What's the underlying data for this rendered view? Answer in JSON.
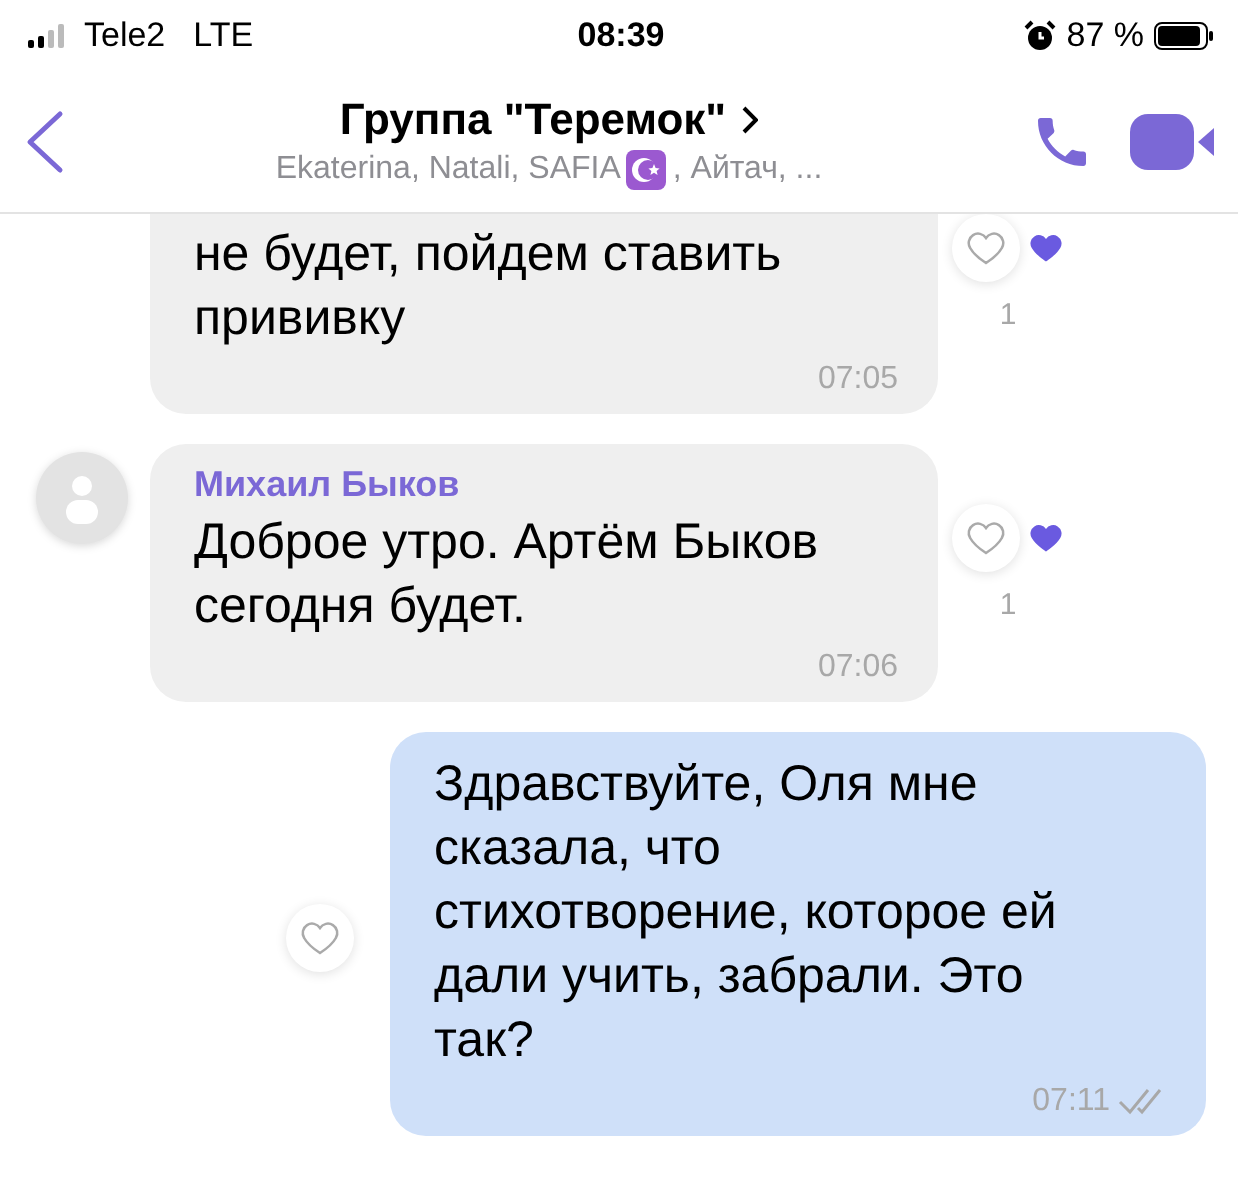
{
  "status_bar": {
    "carrier": "Tele2",
    "network": "LTE",
    "time": "08:39",
    "battery": "87 %"
  },
  "header": {
    "title": "Группа \"Теремок\"",
    "subtitle_start": "Ekaterina, Natali, SAFIA",
    "subtitle_end": ", Айтач, ..."
  },
  "messages": [
    {
      "kind": "incoming",
      "continued": true,
      "text": "не будет, пойдем ставить\nпрививку",
      "time": "07:05",
      "reaction": {
        "liked": false,
        "count": "1"
      }
    },
    {
      "kind": "incoming",
      "continued": false,
      "sender": "Михаил Быков",
      "text": "Доброе утро. Артём Быков\nсегодня будет.",
      "time": "07:06",
      "reaction": {
        "liked": false,
        "count": "1"
      }
    },
    {
      "kind": "outgoing",
      "text": "Здравствуйте, Оля мне\nсказала, что\nстихотворение, которое ей\nдали учить, забрали. Это\nтак?",
      "time": "07:11",
      "read": true,
      "reaction": {
        "liked": false
      }
    }
  ]
}
